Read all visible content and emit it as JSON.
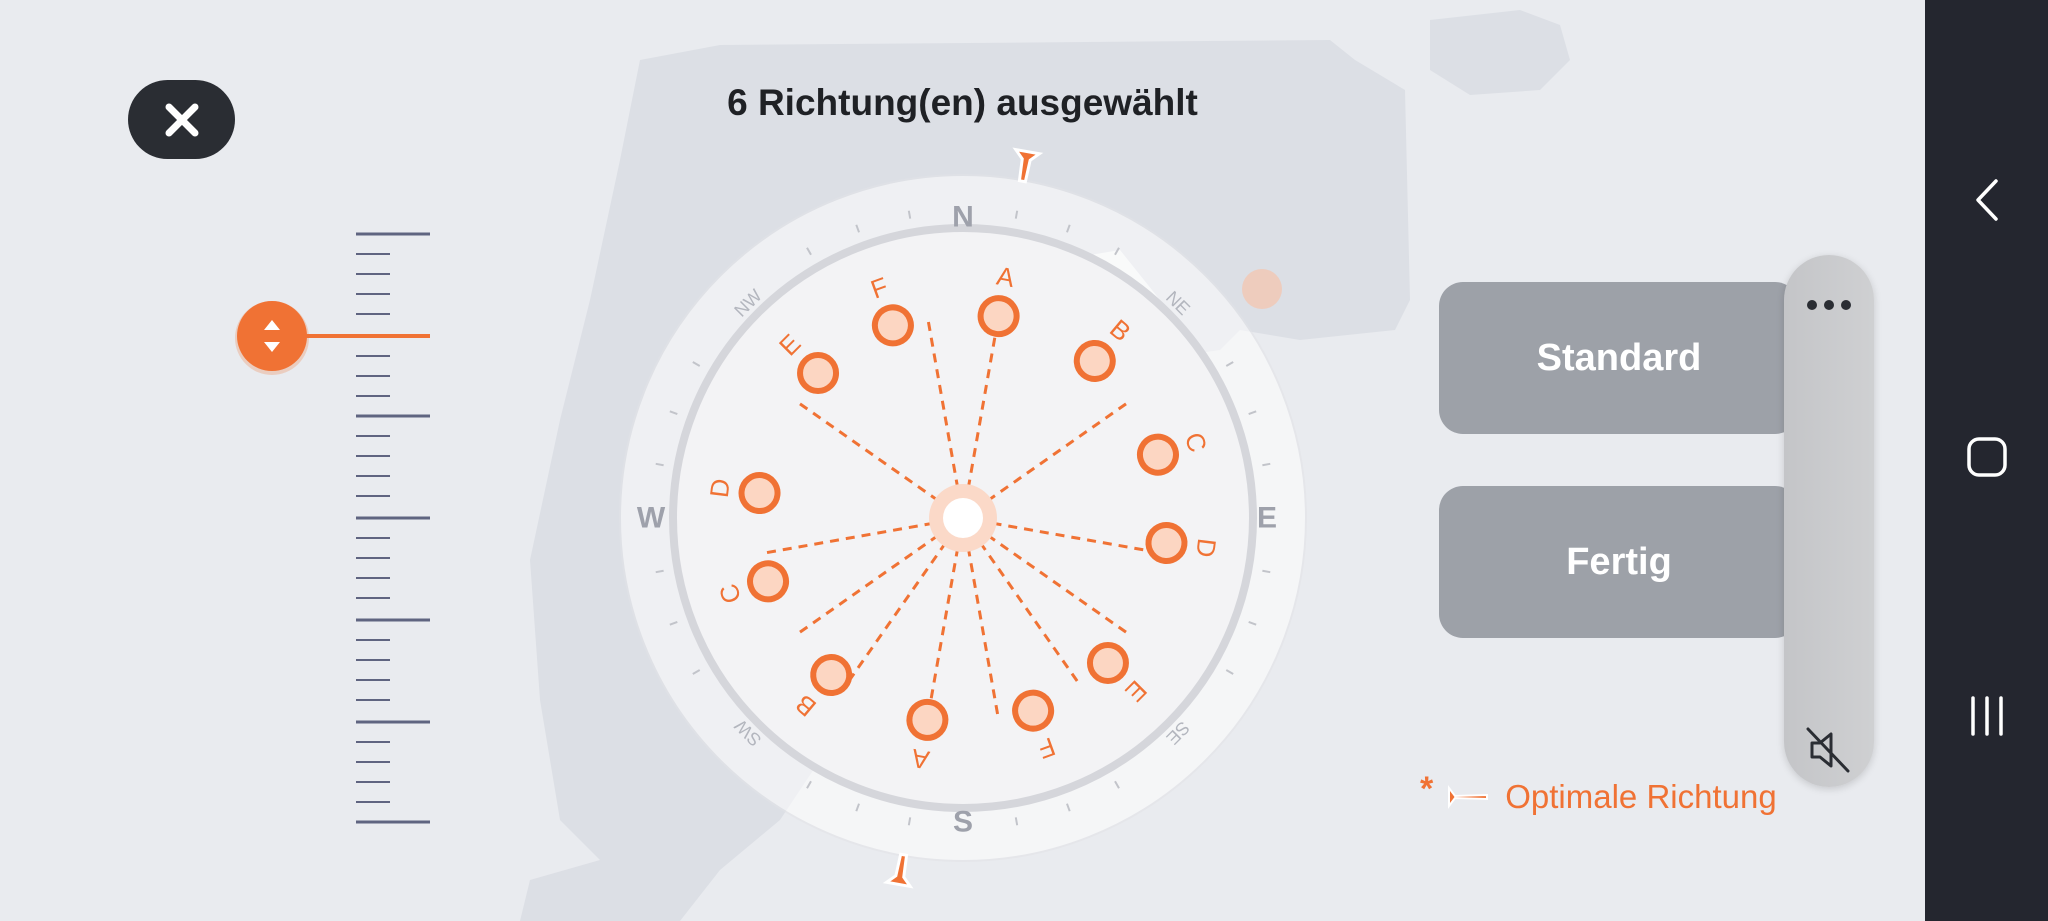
{
  "header": {
    "title": "6 Richtung(en) ausgewählt"
  },
  "compass": {
    "cardinals": {
      "north": "N",
      "east": "E",
      "south": "S",
      "west": "W"
    },
    "intercardinals": {
      "northeast": "NE",
      "southeast": "SE",
      "southwest": "SW",
      "northwest": "NW"
    },
    "direction_labels": [
      "A",
      "B",
      "C",
      "D",
      "E",
      "F"
    ]
  },
  "buttons": {
    "standard": "Standard",
    "done": "Fertig"
  },
  "legend": {
    "marker": "*",
    "text": "Optimale Richtung"
  },
  "colors": {
    "accent": "#f07234",
    "button_bg": "#9da1a8",
    "dark": "#2a2d33",
    "navbar": "#24262f"
  },
  "icons": {
    "close": "close-icon",
    "slider_handle": "up-down-arrows-icon",
    "more": "more-horizontal-icon",
    "mute": "speaker-muted-icon",
    "nav_back": "chevron-left-icon",
    "nav_home": "home-square-icon",
    "nav_recents": "recents-icon"
  }
}
